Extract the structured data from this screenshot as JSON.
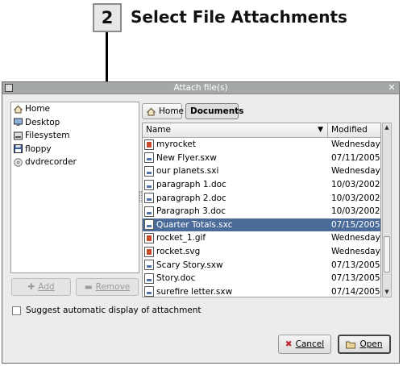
{
  "callout": {
    "step_number": "2",
    "step_title": "Select File Attachments"
  },
  "window": {
    "title": "Attach file(s)",
    "close_glyph": "✕"
  },
  "places": {
    "items": [
      {
        "label": "Home",
        "icon": "home-icon"
      },
      {
        "label": "Desktop",
        "icon": "desktop-icon"
      },
      {
        "label": "Filesystem",
        "icon": "filesystem-icon"
      },
      {
        "label": "floppy",
        "icon": "floppy-icon"
      },
      {
        "label": "dvdrecorder",
        "icon": "cdrom-icon"
      }
    ],
    "add_label": "Add",
    "remove_label": "Remove"
  },
  "path_bar": {
    "home_label": "Home",
    "current_label": "Documents"
  },
  "file_list": {
    "columns": {
      "name": "Name",
      "modified": "Modified"
    },
    "rows": [
      {
        "name": "myrocket",
        "modified": "Wednesday",
        "icon": "image-file-icon"
      },
      {
        "name": "New Flyer.sxw",
        "modified": "07/11/2005",
        "icon": "document-file-icon"
      },
      {
        "name": "our planets.sxi",
        "modified": "Wednesday",
        "icon": "presentation-file-icon"
      },
      {
        "name": "paragraph 1.doc",
        "modified": "10/03/2002",
        "icon": "document-file-icon"
      },
      {
        "name": "paragraph 2.doc",
        "modified": "10/03/2002",
        "icon": "document-file-icon"
      },
      {
        "name": "Paragraph 3.doc",
        "modified": "10/03/2002",
        "icon": "document-file-icon"
      },
      {
        "name": "Quarter Totals.sxc",
        "modified": "07/15/2005",
        "icon": "spreadsheet-file-icon",
        "selected": true
      },
      {
        "name": "rocket_1.gif",
        "modified": "Wednesday",
        "icon": "image-file-icon"
      },
      {
        "name": "rocket.svg",
        "modified": "Wednesday",
        "icon": "image-file-icon"
      },
      {
        "name": "Scary Story.sxw",
        "modified": "07/13/2005",
        "icon": "document-file-icon"
      },
      {
        "name": "Story.doc",
        "modified": "07/13/2005",
        "icon": "document-file-icon"
      },
      {
        "name": "surefire letter.sxw",
        "modified": "07/14/2005",
        "icon": "document-file-icon"
      }
    ]
  },
  "options": {
    "suggest_label": "Suggest automatic display of attachment"
  },
  "actions": {
    "cancel_label": "Cancel",
    "open_label": "Open"
  },
  "colors": {
    "selection": "#4b6b98",
    "titlebar": "#a4a8a8"
  }
}
